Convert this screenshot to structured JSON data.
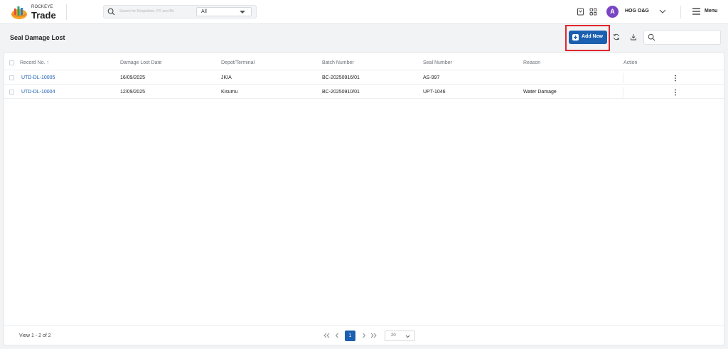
{
  "brand": {
    "top": "ROCKEYE",
    "main": "Trade"
  },
  "search": {
    "placeholder": "Search for Requisition, PO and Mc",
    "scope": "All"
  },
  "user": {
    "initial": "A",
    "name": "HOG O&G"
  },
  "menu": {
    "label": "Menu"
  },
  "page": {
    "title": "Seal Damage Lost",
    "add_label": "Add New"
  },
  "table": {
    "columns": [
      "Record No. ↑",
      "Damage Lost Date",
      "Depot/Terminal",
      "Batch Number",
      "Seal Number",
      "Reason",
      "Action"
    ],
    "rows": [
      {
        "record": "UTD-DL-10005",
        "date": "16/09/2025",
        "depot": "JKIA",
        "batch": "BC-20250916/01",
        "seal": "AS-997",
        "reason": ""
      },
      {
        "record": "UTD-DL-10004",
        "date": "12/09/2025",
        "depot": "Kisumu",
        "batch": "BC-20250910/01",
        "seal": "UPT-1046",
        "reason": "Water Damage"
      }
    ]
  },
  "footer": {
    "view": "View 1 - 2 of 2",
    "page": "1",
    "page_size": "20"
  },
  "icons": [
    "search-icon",
    "bookmark-icon",
    "apps-grid-icon",
    "chevron-down-icon",
    "hamburger-icon",
    "plus-icon",
    "refresh-icon",
    "download-icon",
    "kebab-icon",
    "first-page-icon",
    "prev-page-icon",
    "next-page-icon",
    "last-page-icon"
  ],
  "colors": {
    "accent": "#1b5fb0",
    "avatar": "#7a45c4",
    "highlight": "#e0262c"
  }
}
